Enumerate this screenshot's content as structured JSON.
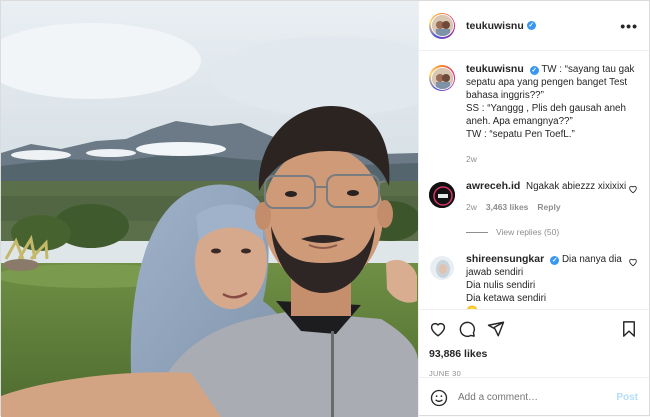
{
  "header": {
    "username": "teukuwisnu",
    "more_label": "•••"
  },
  "caption": {
    "username": "teukuwisnu",
    "lines": [
      "TW : “sayang tau gak",
      "sepatu apa yang pengen banget Test",
      "bahasa inggris??”",
      "SS : “Yanggg , Plis deh gausah aneh",
      "aneh. Apa emangnya??”",
      "TW : “sepatu Pen ToefL.”"
    ],
    "age": "2w"
  },
  "comments": [
    {
      "username": "awreceh.id",
      "text": "Ngakak abiezzz xixixixi",
      "age": "2w",
      "likes": "3,463 likes",
      "reply_label": "Reply",
      "view_replies": "View replies (50)"
    },
    {
      "username": "shireensungkar",
      "lines": [
        "Dia nanya dia",
        "jawab sendiri",
        "Dia nulis sendiri",
        "Dia ketawa sendiri"
      ],
      "emoji": "😁"
    }
  ],
  "actions": {
    "likes": "93,886 likes",
    "date": "JUNE 30"
  },
  "add_comment": {
    "placeholder": "Add a comment…",
    "post_label": "Post",
    "emoji_icon": "smiley-icon"
  },
  "colors": {
    "verified": "#3897f0",
    "post_button": "#b2dffc",
    "muted": "#8e8e8e"
  }
}
